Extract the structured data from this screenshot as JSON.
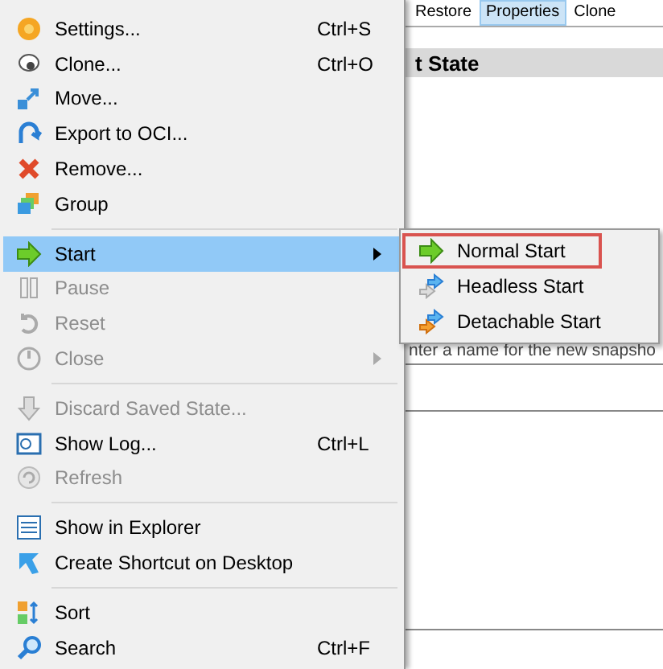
{
  "background": {
    "tabs": [
      {
        "label": "Restore",
        "selected": false
      },
      {
        "label": "Properties",
        "selected": true
      },
      {
        "label": "Clone",
        "selected": false
      }
    ],
    "section_header": "t State",
    "hint_text": "nter a name for the new snapsho"
  },
  "menu": {
    "groups": [
      [
        {
          "label": "Settings...",
          "shortcut": "Ctrl+S",
          "disabled": false,
          "selected": false,
          "submenu": false
        },
        {
          "label": "Clone...",
          "shortcut": "Ctrl+O",
          "disabled": false,
          "selected": false,
          "submenu": false
        },
        {
          "label": "Move...",
          "disabled": false,
          "selected": false,
          "submenu": false
        },
        {
          "label": "Export to OCI...",
          "disabled": false,
          "selected": false,
          "submenu": false
        },
        {
          "label": "Remove...",
          "disabled": false,
          "selected": false,
          "submenu": false
        },
        {
          "label": "Group",
          "disabled": false,
          "selected": false,
          "submenu": false
        }
      ],
      [
        {
          "label": "Start",
          "disabled": false,
          "selected": true,
          "submenu": true
        },
        {
          "label": "Pause",
          "disabled": true,
          "selected": false,
          "submenu": false
        },
        {
          "label": "Reset",
          "disabled": true,
          "selected": false,
          "submenu": false
        },
        {
          "label": "Close",
          "disabled": true,
          "selected": false,
          "submenu": true
        }
      ],
      [
        {
          "label": "Discard Saved State...",
          "disabled": true,
          "selected": false,
          "submenu": false
        },
        {
          "label": "Show Log...",
          "shortcut": "Ctrl+L",
          "disabled": false,
          "selected": false,
          "submenu": false
        },
        {
          "label": "Refresh",
          "disabled": true,
          "selected": false,
          "submenu": false
        }
      ],
      [
        {
          "label": "Show in Explorer",
          "disabled": false,
          "selected": false,
          "submenu": false
        },
        {
          "label": "Create Shortcut on Desktop",
          "disabled": false,
          "selected": false,
          "submenu": false
        }
      ],
      [
        {
          "label": "Sort",
          "disabled": false,
          "selected": false,
          "submenu": false
        },
        {
          "label": "Search",
          "shortcut": "Ctrl+F",
          "disabled": false,
          "selected": false,
          "submenu": false
        }
      ]
    ]
  },
  "submenu": {
    "items": [
      {
        "label": "Normal Start",
        "selected": true
      },
      {
        "label": "Headless Start",
        "selected": false
      },
      {
        "label": "Detachable Start",
        "selected": false
      }
    ]
  }
}
